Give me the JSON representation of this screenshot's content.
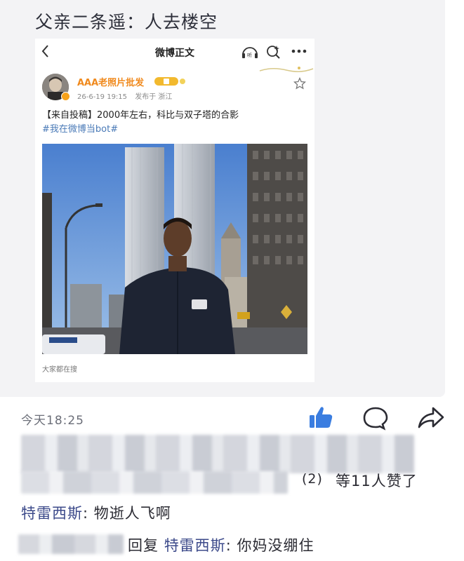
{
  "post": {
    "caption": "父亲二条遥：人去楼空"
  },
  "weibo": {
    "page_title": "微博正文",
    "back_icon": "chevron-left-icon",
    "listen_icon": "listen-icon",
    "search_icon": "search-icon",
    "more_icon": "more-icon",
    "username": "AAA老照片批发",
    "date": "26-6-19 19:15",
    "location": "发布于 浙江",
    "text": "【来自投稿】2000年左右，科比与双子塔的合影",
    "hashtag": "#我在微博当bot#",
    "footer": "大家都在搜",
    "accent": "#f08a1e",
    "link_color": "#4a7ab7"
  },
  "moments": {
    "time": "今天18:25",
    "like_icon": "thumbs-up-icon",
    "comment_icon": "comment-icon",
    "share_icon": "share-icon",
    "like_color": "#3a7de0",
    "likes_count": "(2)",
    "likes_text": "等11人赞了",
    "comments": [
      {
        "author": "特雷西斯",
        "separator": ":",
        "text": "物逝人飞啊"
      },
      {
        "reply_word": "回复",
        "author": "特雷西斯",
        "separator": ":",
        "text": "你妈没绷住"
      }
    ]
  }
}
